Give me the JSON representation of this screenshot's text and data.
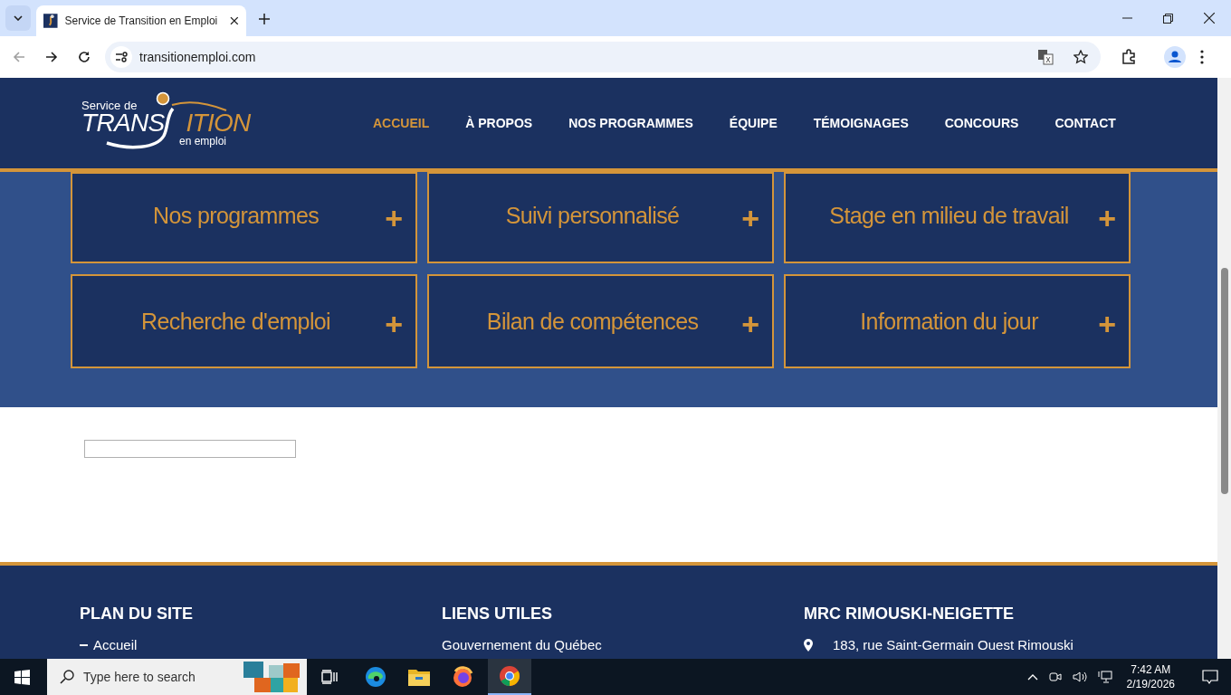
{
  "browser": {
    "tab_title": "Service de Transition en Emploi",
    "url": "transitionemploi.com"
  },
  "logo": {
    "line_1": "Service de",
    "line_2a": "TRANS",
    "line_2b": "ITION",
    "line_3": "en emploi"
  },
  "nav": [
    {
      "label": "ACCUEIL",
      "selected": true
    },
    {
      "label": "À PROPOS",
      "selected": false
    },
    {
      "label": "NOS PROGRAMMES",
      "selected": false
    },
    {
      "label": "ÉQUIPE",
      "selected": false
    },
    {
      "label": "TÉMOIGNAGES",
      "selected": false
    },
    {
      "label": "CONCOURS",
      "selected": false
    },
    {
      "label": "CONTACT",
      "selected": false
    }
  ],
  "cards": [
    {
      "title": "Nos programmes",
      "toggle": "+"
    },
    {
      "title": "Suivi personnalisé",
      "toggle": "+"
    },
    {
      "title": "Stage en milieu de travail",
      "toggle": "+"
    },
    {
      "title": "Recherche d'emploi",
      "toggle": "+"
    },
    {
      "title": "Bilan de compétences",
      "toggle": "+"
    },
    {
      "title": "Information du jour",
      "toggle": "+"
    }
  ],
  "footer": [
    {
      "heading": "PLAN DU SITE",
      "kind": "dash",
      "items": [
        "Accueil"
      ]
    },
    {
      "heading": "LIENS UTILES",
      "kind": "plain",
      "items": [
        "Gouvernement du Québec"
      ]
    },
    {
      "heading": "MRC RIMOUSKI-NEIGETTE",
      "kind": "pin",
      "items": [
        "183, rue Saint-Germain Ouest Rimouski"
      ]
    }
  ],
  "taskbar": {
    "search_placeholder": "Type here to search",
    "time": "7:42 AM",
    "date": "2/19/2026"
  }
}
